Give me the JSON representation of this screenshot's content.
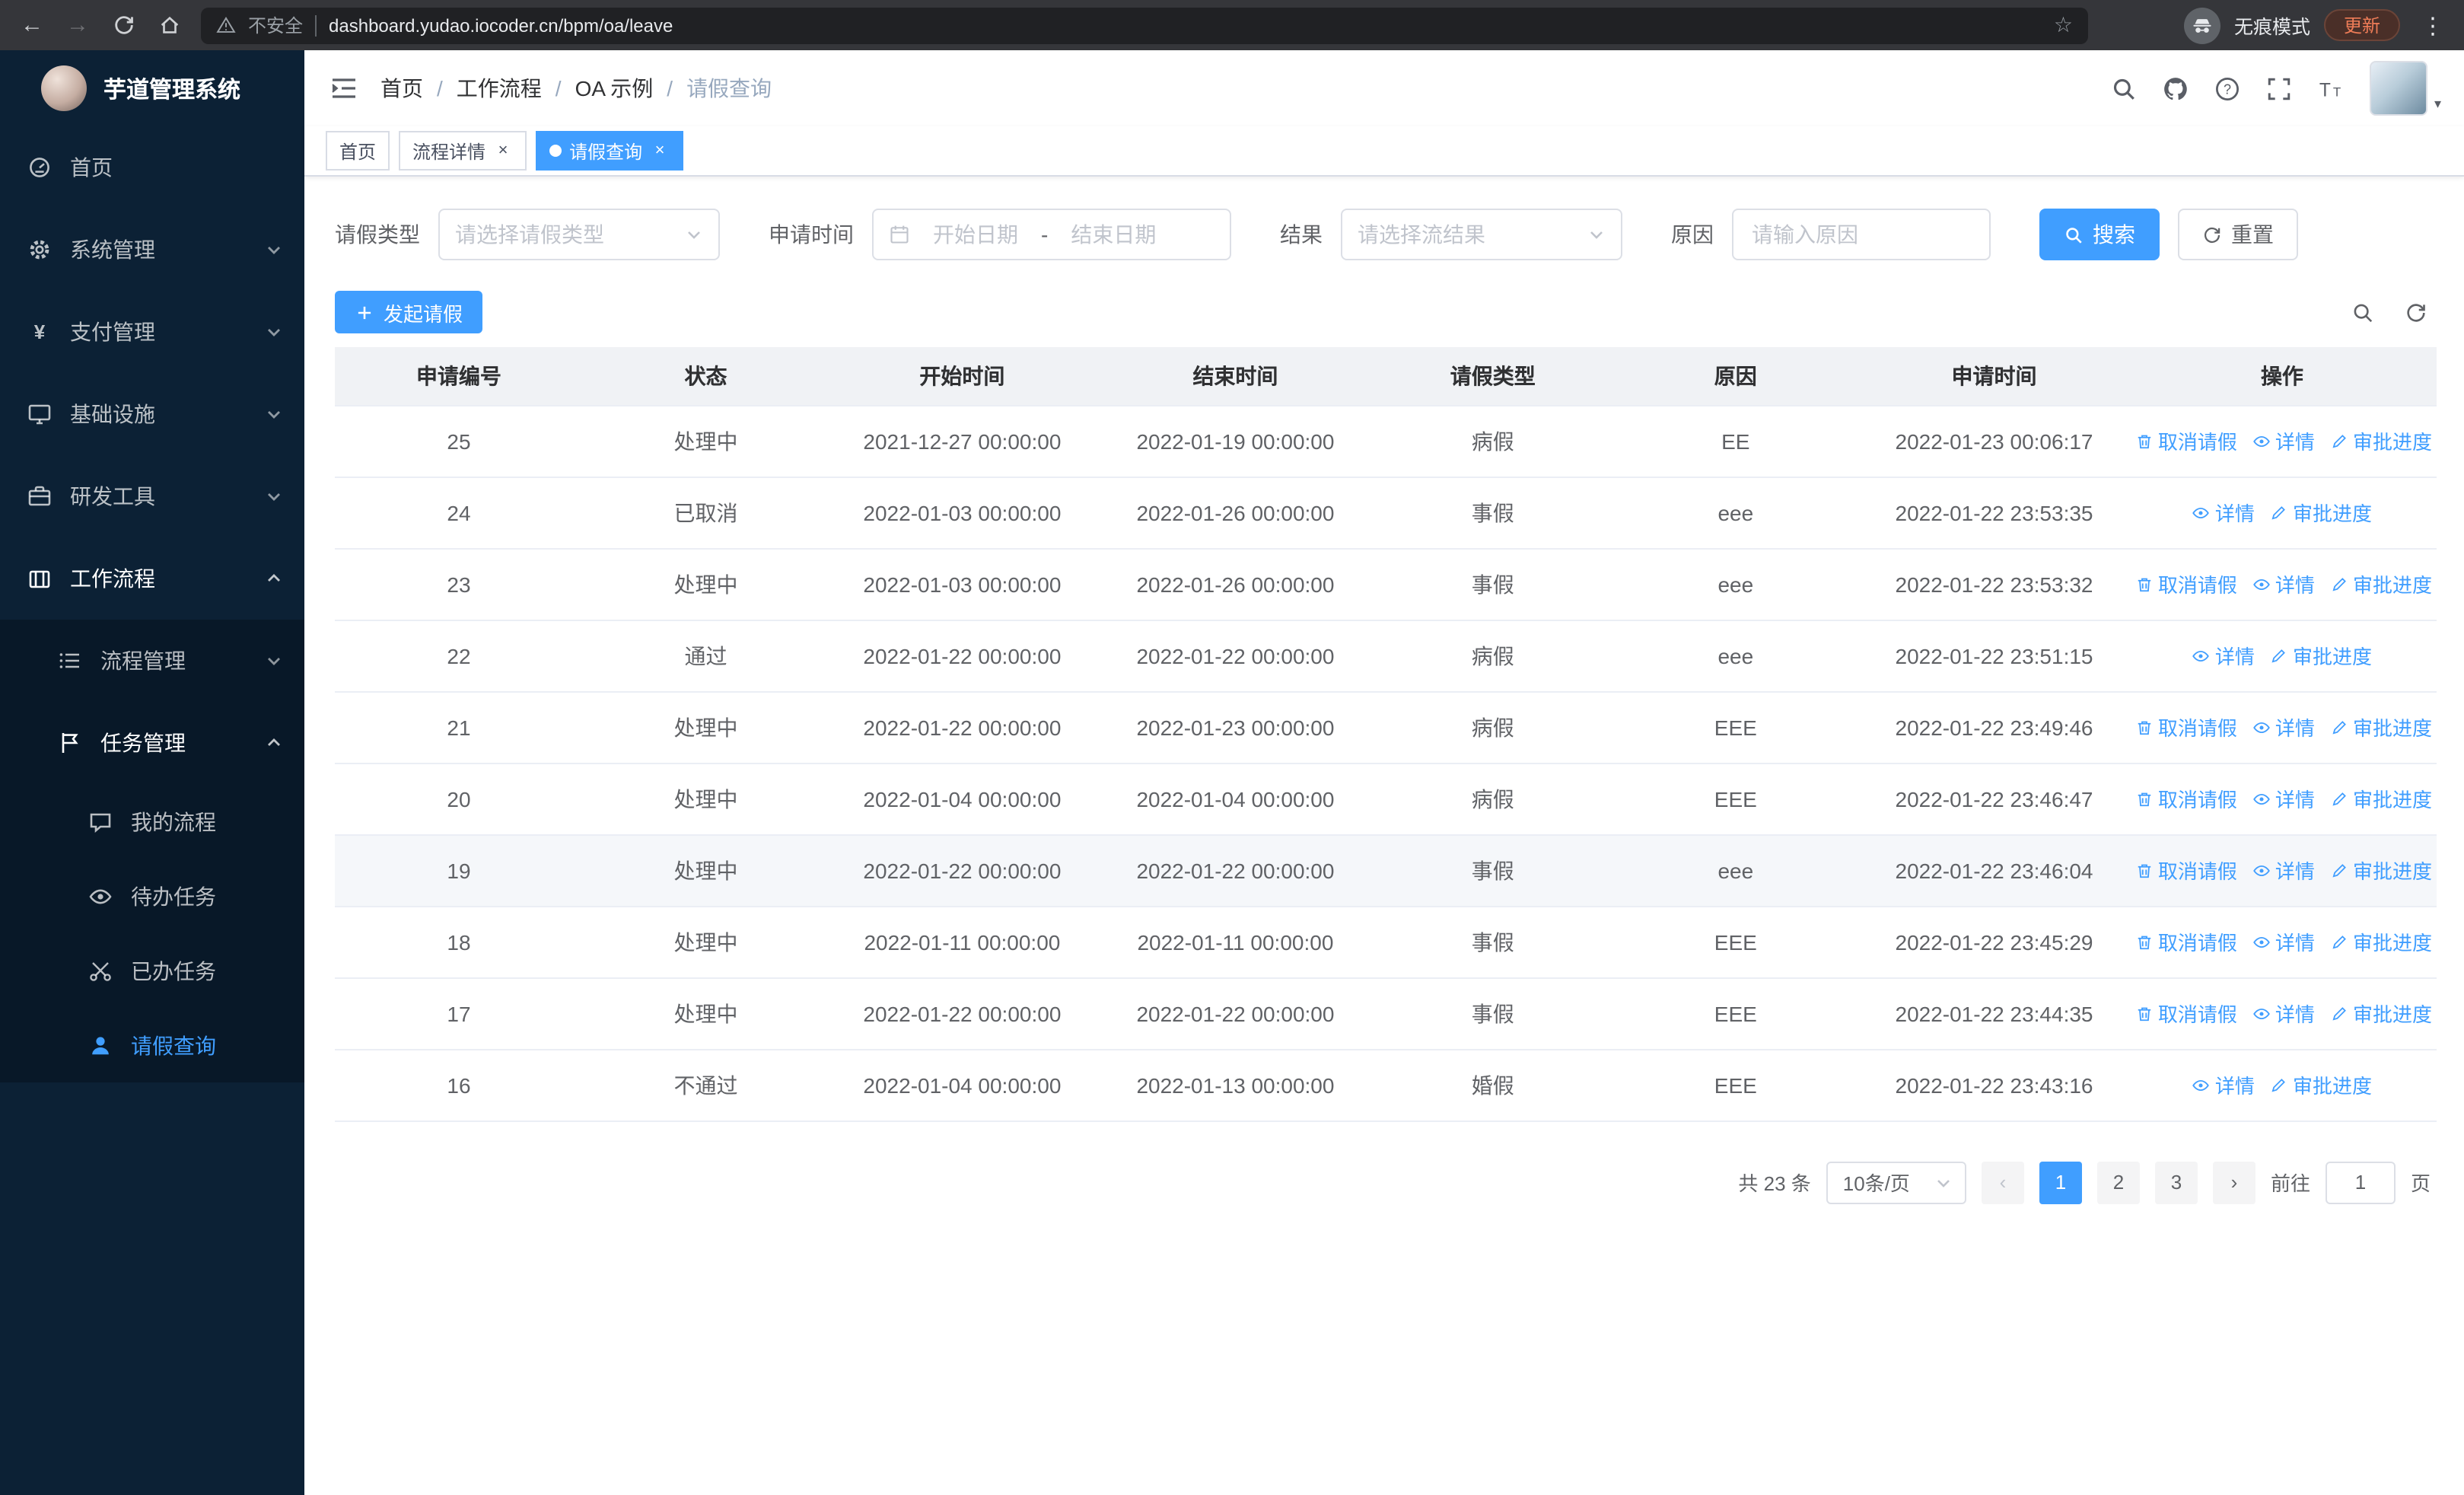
{
  "theme": {
    "accent": "#409eff",
    "sidebar_bg": "#0c2135",
    "sidebar_submenu_bg": "#081828",
    "table_header_bg": "#f0f2f5"
  },
  "browser": {
    "security_text": "不安全",
    "url": "dashboard.yudao.iocoder.cn/bpm/oa/leave",
    "incognito_text": "无痕模式",
    "update_text": "更新"
  },
  "sidebar": {
    "logo_title": "芋道管理系统",
    "items": {
      "home": "首页",
      "system": "系统管理",
      "payment": "支付管理",
      "infra": "基础设施",
      "devtools": "研发工具",
      "workflow": "工作流程",
      "process_mgmt": "流程管理",
      "task_mgmt": "任务管理",
      "my_process": "我的流程",
      "todo_tasks": "待办任务",
      "done_tasks": "已办任务",
      "leave_query": "请假查询"
    }
  },
  "header": {
    "breadcrumb": {
      "items": [
        "首页",
        "工作流程",
        "OA 示例",
        "请假查询"
      ],
      "separator": "/"
    }
  },
  "tabs": {
    "home": "首页",
    "process_detail": "流程详情",
    "leave_query": "请假查询"
  },
  "filters": {
    "leave_type_label": "请假类型",
    "leave_type_placeholder": "请选择请假类型",
    "apply_time_label": "申请时间",
    "start_date_placeholder": "开始日期",
    "range_separator": "-",
    "end_date_placeholder": "结束日期",
    "result_label": "结果",
    "result_placeholder": "请选择流结果",
    "reason_label": "原因",
    "reason_placeholder": "请输入原因",
    "search_label": "搜索",
    "reset_label": "重置"
  },
  "toolbar": {
    "create_label": "发起请假"
  },
  "table": {
    "columns": [
      "申请编号",
      "状态",
      "开始时间",
      "结束时间",
      "请假类型",
      "原因",
      "申请时间",
      "操作"
    ],
    "action_labels": {
      "cancel": "取消请假",
      "detail": "详情",
      "progress": "审批进度"
    },
    "action_icon_names": {
      "cancel": "trash-icon",
      "detail": "eye-icon",
      "progress": "edit-icon"
    },
    "rows": [
      {
        "id": "25",
        "status": "处理中",
        "start": "2021-12-27 00:00:00",
        "end": "2022-01-19 00:00:00",
        "type": "病假",
        "reason": "EE",
        "apply_time": "2022-01-23 00:06:17",
        "actions": [
          "cancel",
          "detail",
          "progress"
        ],
        "highlighted": false
      },
      {
        "id": "24",
        "status": "已取消",
        "start": "2022-01-03 00:00:00",
        "end": "2022-01-26 00:00:00",
        "type": "事假",
        "reason": "eee",
        "apply_time": "2022-01-22 23:53:35",
        "actions": [
          "detail",
          "progress"
        ],
        "highlighted": false
      },
      {
        "id": "23",
        "status": "处理中",
        "start": "2022-01-03 00:00:00",
        "end": "2022-01-26 00:00:00",
        "type": "事假",
        "reason": "eee",
        "apply_time": "2022-01-22 23:53:32",
        "actions": [
          "cancel",
          "detail",
          "progress"
        ],
        "highlighted": false
      },
      {
        "id": "22",
        "status": "通过",
        "start": "2022-01-22 00:00:00",
        "end": "2022-01-22 00:00:00",
        "type": "病假",
        "reason": "eee",
        "apply_time": "2022-01-22 23:51:15",
        "actions": [
          "detail",
          "progress"
        ],
        "highlighted": false
      },
      {
        "id": "21",
        "status": "处理中",
        "start": "2022-01-22 00:00:00",
        "end": "2022-01-23 00:00:00",
        "type": "病假",
        "reason": "EEE",
        "apply_time": "2022-01-22 23:49:46",
        "actions": [
          "cancel",
          "detail",
          "progress"
        ],
        "highlighted": false
      },
      {
        "id": "20",
        "status": "处理中",
        "start": "2022-01-04 00:00:00",
        "end": "2022-01-04 00:00:00",
        "type": "病假",
        "reason": "EEE",
        "apply_time": "2022-01-22 23:46:47",
        "actions": [
          "cancel",
          "detail",
          "progress"
        ],
        "highlighted": false
      },
      {
        "id": "19",
        "status": "处理中",
        "start": "2022-01-22 00:00:00",
        "end": "2022-01-22 00:00:00",
        "type": "事假",
        "reason": "eee",
        "apply_time": "2022-01-22 23:46:04",
        "actions": [
          "cancel",
          "detail",
          "progress"
        ],
        "highlighted": true
      },
      {
        "id": "18",
        "status": "处理中",
        "start": "2022-01-11 00:00:00",
        "end": "2022-01-11 00:00:00",
        "type": "事假",
        "reason": "EEE",
        "apply_time": "2022-01-22 23:45:29",
        "actions": [
          "cancel",
          "detail",
          "progress"
        ],
        "highlighted": false
      },
      {
        "id": "17",
        "status": "处理中",
        "start": "2022-01-22 00:00:00",
        "end": "2022-01-22 00:00:00",
        "type": "事假",
        "reason": "EEE",
        "apply_time": "2022-01-22 23:44:35",
        "actions": [
          "cancel",
          "detail",
          "progress"
        ],
        "highlighted": false
      },
      {
        "id": "16",
        "status": "不通过",
        "start": "2022-01-04 00:00:00",
        "end": "2022-01-13 00:00:00",
        "type": "婚假",
        "reason": "EEE",
        "apply_time": "2022-01-22 23:43:16",
        "actions": [
          "detail",
          "progress"
        ],
        "highlighted": false
      }
    ]
  },
  "pagination": {
    "total_text": "共 23 条",
    "page_size_text": "10条/页",
    "pages": [
      "1",
      "2",
      "3"
    ],
    "active_page": "1",
    "goto_prefix": "前往",
    "goto_value": "1",
    "goto_suffix": "页"
  }
}
